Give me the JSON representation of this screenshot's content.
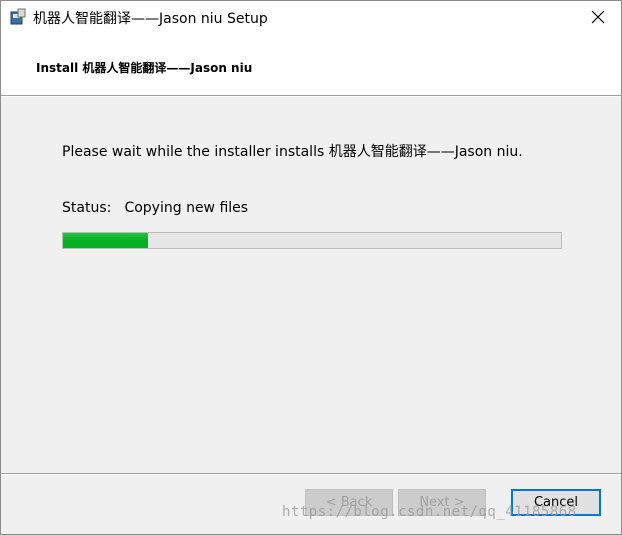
{
  "window": {
    "title": "机器人智能翻译——Jason niu Setup"
  },
  "header": {
    "title": "Install 机器人智能翻译——Jason niu"
  },
  "body": {
    "wait_message": "Please wait while the installer installs 机器人智能翻译——Jason niu.",
    "status_label": "Status:",
    "status_value": "Copying new files",
    "progress_fraction": 0.17
  },
  "buttons": {
    "back": "< Back",
    "next": "Next >",
    "cancel": "Cancel"
  },
  "watermark": "https://blog.csdn.net/qq_41185868",
  "colors": {
    "progress": "#06b025",
    "focus_border": "#0078d7"
  }
}
